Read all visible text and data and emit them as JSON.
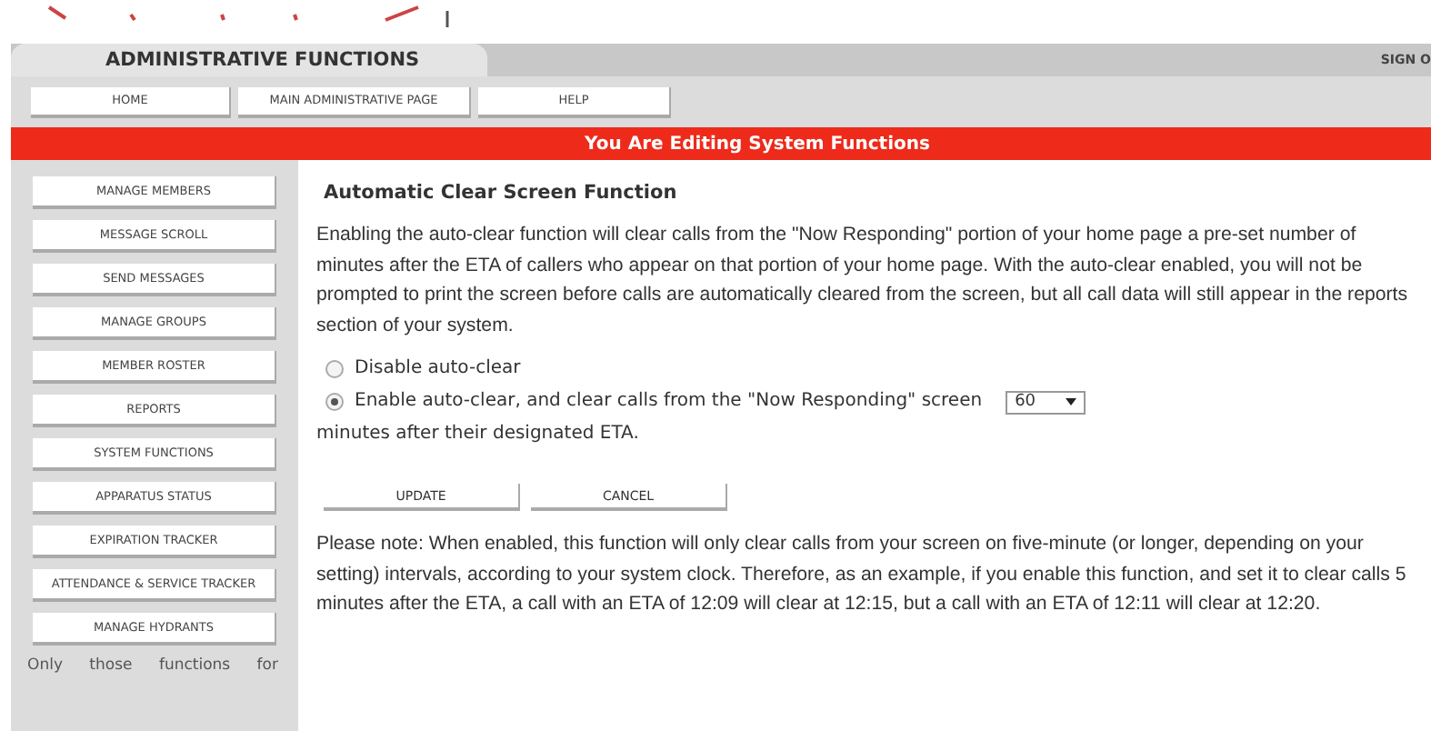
{
  "header": {
    "tab": "ADMINISTRATIVE FUNCTIONS",
    "sign_out": "SIGN O"
  },
  "nav": [
    "HOME",
    "MAIN ADMINISTRATIVE PAGE",
    "HELP"
  ],
  "banner": "You Are Editing System Functions",
  "sidebar": {
    "items": [
      "MANAGE MEMBERS",
      "MESSAGE SCROLL",
      "SEND MESSAGES",
      "MANAGE GROUPS",
      "MEMBER ROSTER",
      "REPORTS",
      "SYSTEM FUNCTIONS",
      "APPARATUS STATUS",
      "EXPIRATION TRACKER",
      "ATTENDANCE & SERVICE TRACKER",
      "MANAGE HYDRANTS"
    ],
    "note": "Only those functions for"
  },
  "content": {
    "title": "Automatic Clear Screen Function",
    "intro": "Enabling the auto-clear function will clear calls from the \"Now Responding\" portion of your home page a pre-set number of minutes after the ETA of callers who appear on that portion of your home page. With the auto-clear enabled, you will not be prompted to print the screen before calls are automatically cleared from the screen, but all call data will still appear in the reports section of your system.",
    "options": [
      {
        "label": "Disable auto-clear",
        "selected": false
      },
      {
        "label": "Enable auto-clear, and clear calls from the \"Now Responding\" screen",
        "selected": true,
        "select_value": "60",
        "suffix": "minutes after their designated ETA."
      }
    ],
    "buttons": [
      "UPDATE",
      "CANCEL"
    ],
    "note": "Please note: When enabled, this function will only clear calls from your screen on five-minute (or longer, depending on your setting) intervals, according to your system clock. Therefore, as an example, if you enable this function, and set it to clear calls 5 minutes after the ETA, a call with an ETA of 12:09 will clear at 12:15, but a call with an ETA of 12:11 will clear at 12:20."
  }
}
